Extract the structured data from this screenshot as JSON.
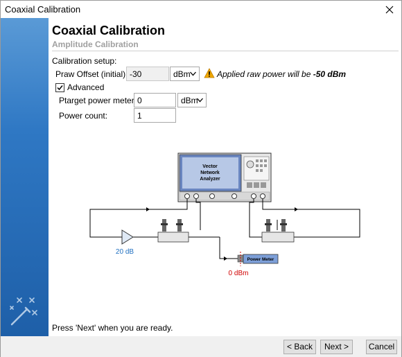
{
  "window": {
    "title": "Coaxial Calibration"
  },
  "page": {
    "heading": "Coaxial Calibration",
    "subheading": "Amplitude Calibration"
  },
  "setup": {
    "section_label": "Calibration setup:",
    "praw_label": "Praw Offset (initial):",
    "praw_value": "-30",
    "praw_unit": "dBm",
    "warning_prefix": "Applied raw power will be",
    "warning_value": "-50 dBm",
    "advanced_label": "Advanced",
    "advanced_checked": true,
    "ptarget_label": "Ptarget power meter:",
    "ptarget_value": "0",
    "ptarget_unit": "dBm",
    "power_count_label": "Power count:",
    "power_count_value": "1"
  },
  "diagram": {
    "vna_line1": "Vector",
    "vna_line2": "Network",
    "vna_line3": "Analyzer",
    "amp_gain": "20 dB",
    "power_meter_label": "Power Meter",
    "power_meter_reading": "0 dBm",
    "colors": {
      "blue_label": "#1f6fc0",
      "red_label": "#d00000"
    }
  },
  "footer": {
    "note": "Press 'Next' when you are ready."
  },
  "buttons": {
    "back": "< Back",
    "next": "Next >",
    "cancel": "Cancel"
  },
  "icons": {
    "close": "close-icon",
    "wizard": "magic-wand-icon",
    "warning": "warning-icon",
    "dropdown": "chevron-down-icon"
  },
  "theme": {
    "sidebar_top": "#5a9ad6",
    "sidebar_bottom": "#1e5fa8"
  }
}
